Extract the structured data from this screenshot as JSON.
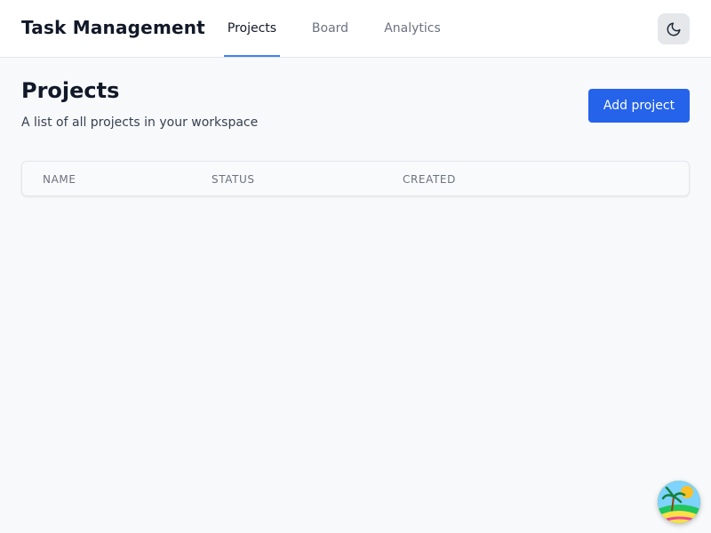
{
  "app": {
    "title": "Task Management"
  },
  "nav": {
    "tabs": [
      {
        "label": "Projects",
        "active": true
      },
      {
        "label": "Board",
        "active": false
      },
      {
        "label": "Analytics",
        "active": false
      }
    ]
  },
  "theme_toggle": {
    "icon": "moon-icon"
  },
  "main": {
    "title": "Projects",
    "subtitle": "A list of all projects in your workspace",
    "add_button_label": "Add project"
  },
  "table": {
    "columns": [
      "NAME",
      "STATUS",
      "CREATED"
    ],
    "rows": []
  },
  "fab": {
    "icon": "island-avatar-icon"
  },
  "colors": {
    "accent": "#2563eb",
    "tab_indicator": "#3b82f6",
    "background": "#f8f9fb",
    "text_primary": "#111827",
    "text_muted": "#6b7280"
  }
}
